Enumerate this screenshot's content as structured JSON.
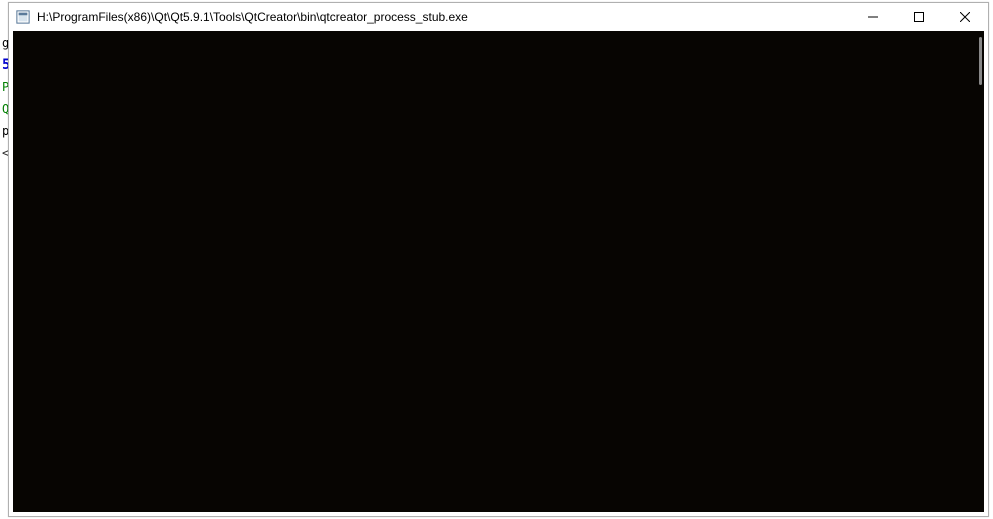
{
  "window": {
    "title": "H:\\ProgramFiles(x86)\\Qt\\Qt5.9.1\\Tools\\QtCreator\\bin\\qtcreator_process_stub.exe"
  },
  "background": {
    "line1": "g",
    "line2": "5",
    "line3": "",
    "line4": "P",
    "line5": "Q",
    "line6": "p",
    "line7": "",
    "line8": "<"
  }
}
